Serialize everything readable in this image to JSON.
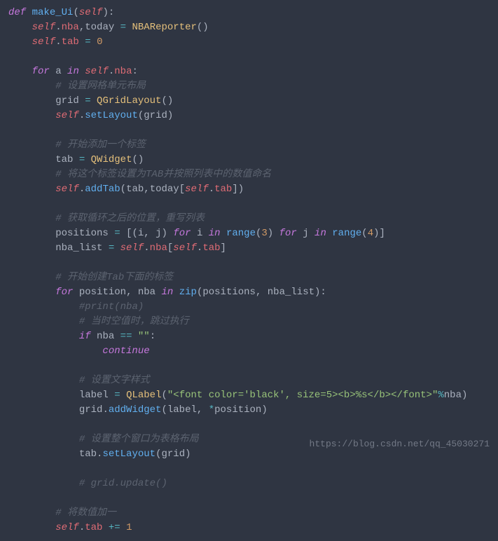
{
  "code": {
    "l1": {
      "def": "def",
      "fname": "make_Ui",
      "self": "self"
    },
    "l2": {
      "self1": "self",
      "p1": "nba",
      "id": "today",
      "op": "=",
      "cls": "NBAReporter"
    },
    "l3": {
      "self": "self",
      "p": "tab",
      "op": "=",
      "num": "0"
    },
    "l5": {
      "for": "for",
      "a": "a",
      "in": "in",
      "self": "self",
      "p": "nba"
    },
    "l6": {
      "c": "# 设置网格单元布局"
    },
    "l7": {
      "id": "grid",
      "op": "=",
      "cls": "QGridLayout"
    },
    "l8": {
      "self": "self",
      "fn": "setLayout",
      "arg": "grid"
    },
    "l10": {
      "c": "# 开始添加一个标签"
    },
    "l11": {
      "id": "tab",
      "op": "=",
      "cls": "QWidget"
    },
    "l12": {
      "c": "# 将这个标签设置为TAB并按照列表中的数值命名"
    },
    "l13": {
      "self": "self",
      "fn": "addTab",
      "a1": "tab",
      "id": "today",
      "self2": "self",
      "p": "tab"
    },
    "l15": {
      "c": "# 获取循环之后的位置，重写列表"
    },
    "l16": {
      "id": "positions",
      "op": "=",
      "i": "i",
      "j": "j",
      "for1": "for",
      "in1": "in",
      "range1": "range",
      "n1": "3",
      "for2": "for",
      "in2": "in",
      "range2": "range",
      "n2": "4"
    },
    "l17": {
      "id": "nba_list",
      "op": "=",
      "self": "self",
      "p": "nba",
      "self2": "self",
      "p2": "tab"
    },
    "l19": {
      "c": "# 开始创建Tab下面的标签"
    },
    "l20": {
      "for": "for",
      "a": "position",
      "b": "nba",
      "in": "in",
      "zip": "zip",
      "arg1": "positions",
      "arg2": "nba_list"
    },
    "l21": {
      "c": "#print(nba)"
    },
    "l22": {
      "c": "# 当时空值时，跳过执行"
    },
    "l23": {
      "if": "if",
      "a": "nba",
      "op": "==",
      "s": "\"\""
    },
    "l24": {
      "kw": "continue"
    },
    "l26": {
      "c": "# 设置文字样式"
    },
    "l27": {
      "id": "label",
      "op": "=",
      "cls": "QLabel",
      "s": "\"<font color='black', size=5><b>%s</b></font>\"",
      "mod": "%",
      "arg": "nba"
    },
    "l28": {
      "id": "grid",
      "fn": "addWidget",
      "a1": "label",
      "star": "*",
      "a2": "position"
    },
    "l30": {
      "c": "# 设置整个窗口为表格布局"
    },
    "l31": {
      "id": "tab",
      "fn": "setLayout",
      "arg": "grid"
    },
    "l33": {
      "c": "# grid.update()"
    },
    "l35": {
      "c": "# 将数值加一"
    },
    "l36": {
      "self": "self",
      "p": "tab",
      "op": "+=",
      "num": "1"
    }
  },
  "watermark": "https://blog.csdn.net/qq_45030271"
}
